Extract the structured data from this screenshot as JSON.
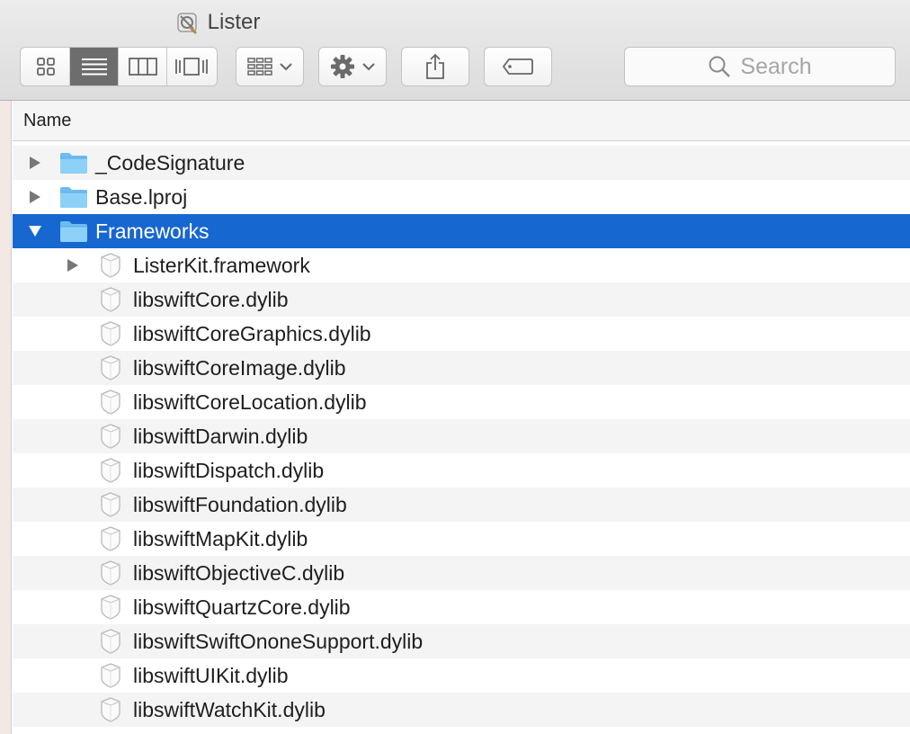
{
  "window": {
    "title": "Lister",
    "title_icon": "app-icon"
  },
  "toolbar": {
    "view_modes": [
      {
        "name": "icon-view-icon",
        "selected": false
      },
      {
        "name": "list-view-icon",
        "selected": true
      },
      {
        "name": "column-view-icon",
        "selected": false
      },
      {
        "name": "cover-flow-icon",
        "selected": false
      }
    ],
    "arrange_icon": "arrange-icon",
    "action_icon": "gear-icon",
    "share_icon": "share-icon",
    "tag_icon": "tag-icon",
    "search": {
      "placeholder": "Search",
      "icon": "search-icon"
    }
  },
  "columns": {
    "name": "Name"
  },
  "colors": {
    "selection": "#1767d0",
    "folder": "#7ac6f5",
    "alt_row": "#f4f4f4"
  },
  "rows": [
    {
      "label": "_CodeSignature",
      "type": "folder",
      "level": 0,
      "disclosure": "collapsed"
    },
    {
      "label": "Base.lproj",
      "type": "folder",
      "level": 0,
      "disclosure": "collapsed"
    },
    {
      "label": "Frameworks",
      "type": "folder",
      "level": 0,
      "disclosure": "expanded",
      "selected": true
    },
    {
      "label": "ListerKit.framework",
      "type": "library",
      "level": 1,
      "disclosure": "collapsed"
    },
    {
      "label": "libswiftCore.dylib",
      "type": "library",
      "level": 1
    },
    {
      "label": "libswiftCoreGraphics.dylib",
      "type": "library",
      "level": 1
    },
    {
      "label": "libswiftCoreImage.dylib",
      "type": "library",
      "level": 1
    },
    {
      "label": "libswiftCoreLocation.dylib",
      "type": "library",
      "level": 1
    },
    {
      "label": "libswiftDarwin.dylib",
      "type": "library",
      "level": 1
    },
    {
      "label": "libswiftDispatch.dylib",
      "type": "library",
      "level": 1
    },
    {
      "label": "libswiftFoundation.dylib",
      "type": "library",
      "level": 1
    },
    {
      "label": "libswiftMapKit.dylib",
      "type": "library",
      "level": 1
    },
    {
      "label": "libswiftObjectiveC.dylib",
      "type": "library",
      "level": 1
    },
    {
      "label": "libswiftQuartzCore.dylib",
      "type": "library",
      "level": 1
    },
    {
      "label": "libswiftSwiftOnoneSupport.dylib",
      "type": "library",
      "level": 1
    },
    {
      "label": "libswiftUIKit.dylib",
      "type": "library",
      "level": 1
    },
    {
      "label": "libswiftWatchKit.dylib",
      "type": "library",
      "level": 1
    }
  ]
}
